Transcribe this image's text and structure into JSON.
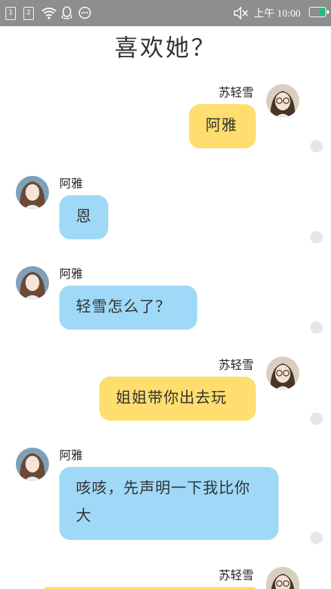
{
  "status_bar": {
    "sim1": "1",
    "sim2": "2",
    "time": "上午 10:00",
    "icons": [
      "sim-card-1-icon",
      "sim-card-2-icon",
      "wifi-icon",
      "qq-icon",
      "chat-icon",
      "mute-icon",
      "battery-icon"
    ],
    "battery_color": "#19c37d"
  },
  "title": "喜欢她？",
  "colors": {
    "left_bubble": "#9fd9f7",
    "right_bubble": "#ffdd6e"
  },
  "messages": [
    {
      "side": "right",
      "sender": "苏轻雪",
      "text": "阿雅"
    },
    {
      "side": "left",
      "sender": "阿雅",
      "text": "恩"
    },
    {
      "side": "left",
      "sender": "阿雅",
      "text": "轻雪怎么了？"
    },
    {
      "side": "right",
      "sender": "苏轻雪",
      "text": "姐姐带你出去玩"
    },
    {
      "side": "left",
      "sender": "阿雅",
      "text": "咳咳，先声明一下我比你大"
    },
    {
      "side": "right",
      "sender": "苏轻雪",
      "text": ""
    }
  ]
}
